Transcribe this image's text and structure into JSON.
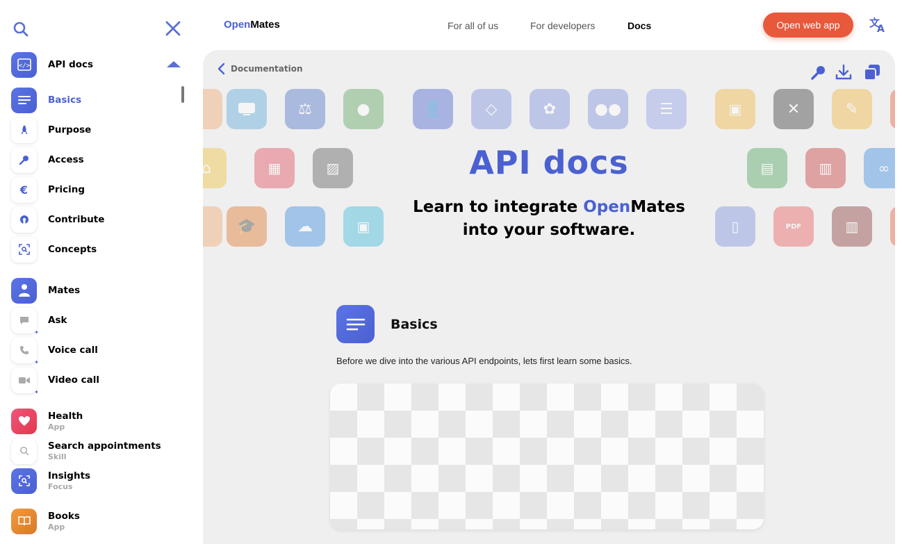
{
  "sidebar": {
    "section_title": "API docs",
    "items": [
      {
        "label": "Basics"
      },
      {
        "label": "Purpose"
      },
      {
        "label": "Access"
      },
      {
        "label": "Pricing"
      },
      {
        "label": "Contribute"
      },
      {
        "label": "Concepts"
      },
      {
        "label": "Mates"
      },
      {
        "label": "Ask"
      },
      {
        "label": "Voice call"
      },
      {
        "label": "Video call"
      },
      {
        "label": "Health",
        "sub": "App"
      },
      {
        "label": "Search appointments",
        "sub": "Skill"
      },
      {
        "label": "Insights",
        "sub": "Focus"
      },
      {
        "label": "Books",
        "sub": "App"
      }
    ]
  },
  "header": {
    "logo_open": "Open",
    "logo_mates": "Mates",
    "nav": [
      "For all of us",
      "For developers",
      "Docs"
    ],
    "cta": "Open web app"
  },
  "main": {
    "breadcrumb": "Documentation",
    "hero_title": "API docs",
    "hero_sub_pre": "Learn to integrate ",
    "hero_sub_open": "Open",
    "hero_sub_post": "Mates",
    "hero_sub_line2": "into your software.",
    "section_title": "Basics",
    "section_desc": "Before we dive into the various API endpoints, lets first learn some basics."
  },
  "colors": {
    "accent": "#4b61d1",
    "cta": "#e8583b",
    "panel": "#efefef"
  }
}
